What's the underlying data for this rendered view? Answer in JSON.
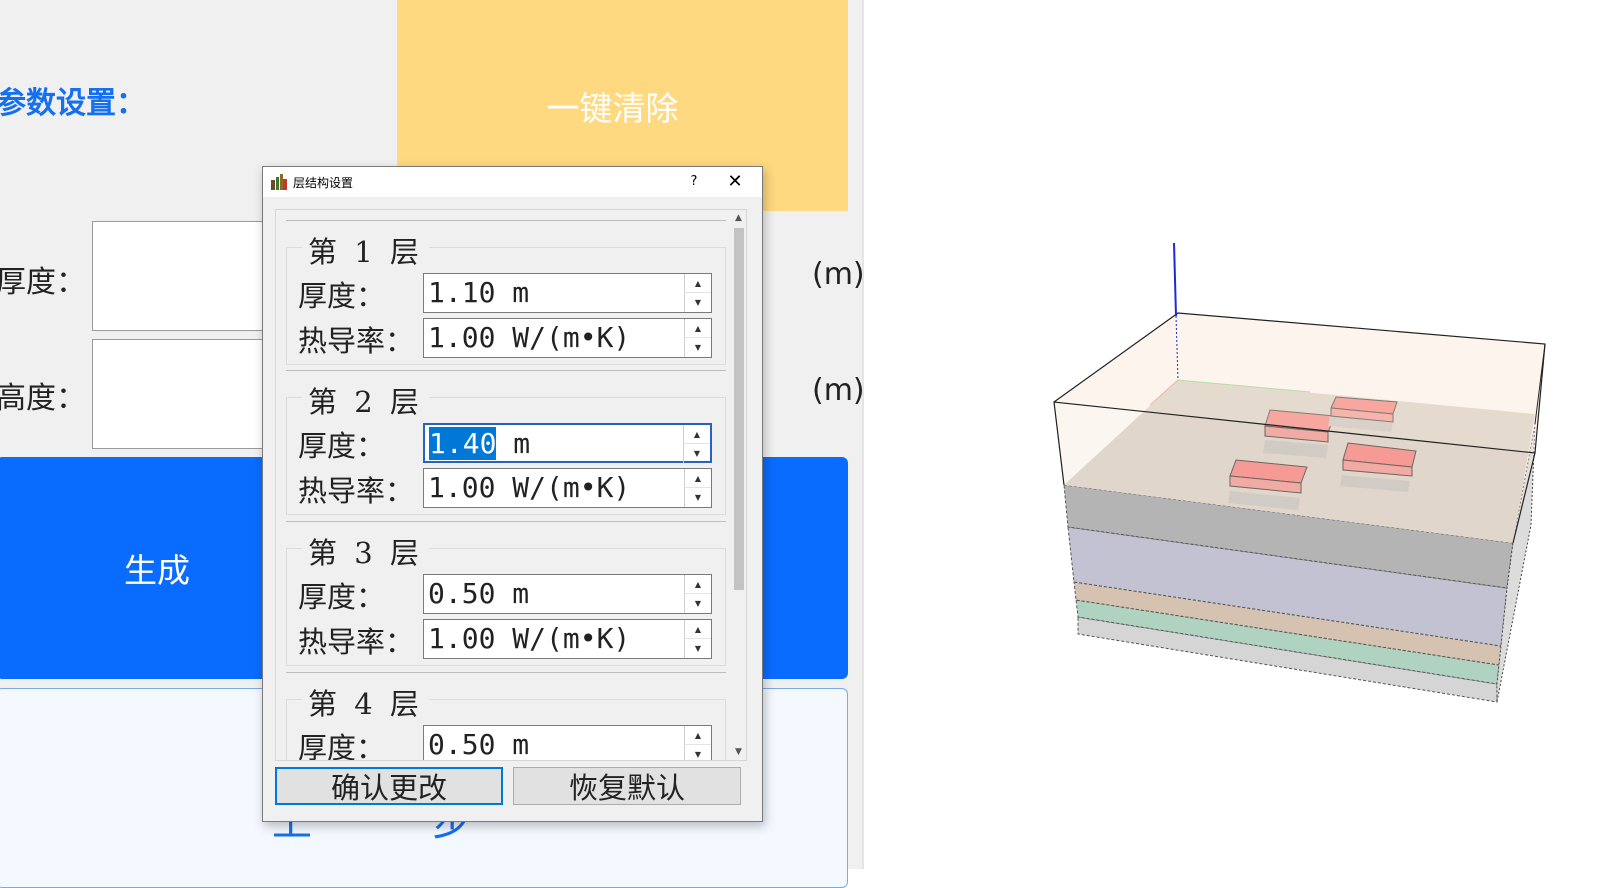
{
  "main": {
    "params_title": "参数设置：",
    "clear_button": "一键清除",
    "thickness_label": "厚度：",
    "height_label": "高度：",
    "unit": "(m)",
    "generate_button": "生成",
    "next_button": "上一步"
  },
  "dialog": {
    "title": "层结构设置",
    "help": "?",
    "close": "✕",
    "thickness_label": "厚度：",
    "conductivity_label": "热导率：",
    "layers": [
      {
        "title": "第 1 层",
        "thickness": "1.10 m",
        "conductivity": "1.00 W/(m•K)"
      },
      {
        "title": "第 2 层",
        "thickness_selected": "1.40",
        "thickness_unit": " m",
        "conductivity": "1.00 W/(m•K)"
      },
      {
        "title": "第 3 层",
        "thickness": "0.50 m",
        "conductivity": "1.00 W/(m•K)"
      },
      {
        "title": "第 4 层",
        "thickness": "0.50 m"
      }
    ],
    "confirm_button": "确认更改",
    "reset_button": "恢复默认"
  },
  "colors": {
    "accent_blue": "#0a6cff",
    "clear_button_yellow": "#ffd97f",
    "title_blue": "#1570ef",
    "chip_red": "#f47272",
    "layer_top": "#fcefe0",
    "layer_grey": "#b4b4b4",
    "layer_lavender": "#c2c2d2",
    "layer_tan": "#d6c2b0",
    "layer_green": "#b0d2c0"
  }
}
